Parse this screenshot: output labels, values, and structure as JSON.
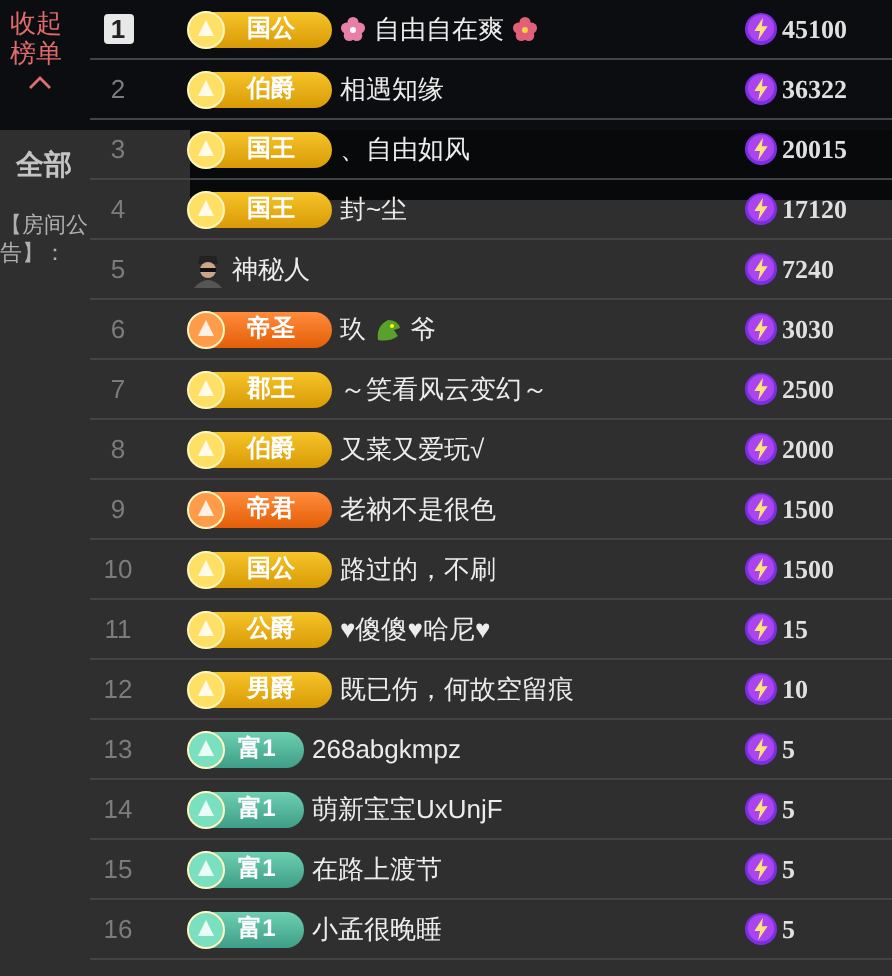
{
  "sidebar": {
    "collapse_label": "收起榜单"
  },
  "tabs": [
    {
      "label": "全部",
      "selected": true
    }
  ],
  "announcement": {
    "label": "【房间公告】："
  },
  "rows": [
    {
      "rank": "1",
      "highlight": true,
      "kind": "gold",
      "badge": "国公",
      "name": "自由自在爽",
      "flower_left": true,
      "flower_right": true,
      "value": "45100"
    },
    {
      "rank": "2",
      "highlight": false,
      "kind": "gold",
      "badge": "伯爵",
      "name": "相遇知缘",
      "value": "36322"
    },
    {
      "rank": "3",
      "highlight": false,
      "kind": "gold",
      "badge": "国王",
      "name": "、自由如风",
      "value": "20015"
    },
    {
      "rank": "4",
      "highlight": false,
      "kind": "gold",
      "badge": "国王",
      "name": "封~尘",
      "value": "17120"
    },
    {
      "rank": "5",
      "highlight": false,
      "kind": "mystery",
      "name": "神秘人",
      "value": "7240"
    },
    {
      "rank": "6",
      "highlight": false,
      "kind": "orange",
      "badge": "帝圣",
      "name": "玖",
      "name_tail": "爷",
      "value": "3030"
    },
    {
      "rank": "7",
      "highlight": false,
      "kind": "gold",
      "badge": "郡王",
      "name": "～笑看风云变幻～",
      "value": "2500"
    },
    {
      "rank": "8",
      "highlight": false,
      "kind": "gold",
      "badge": "伯爵",
      "name": "又菜又爱玩√",
      "value": "2000"
    },
    {
      "rank": "9",
      "highlight": false,
      "kind": "orange",
      "badge": "帝君",
      "name": "老衲不是很色",
      "value": "1500"
    },
    {
      "rank": "10",
      "highlight": false,
      "kind": "gold",
      "badge": "国公",
      "name": "路过的，不刷",
      "value": "1500"
    },
    {
      "rank": "11",
      "highlight": false,
      "kind": "gold",
      "badge": "公爵",
      "name": "♥傻傻♥哈尼♥",
      "value": "15"
    },
    {
      "rank": "12",
      "highlight": false,
      "kind": "gold",
      "badge": "男爵",
      "name": "既已伤，何故空留痕",
      "value": "10"
    },
    {
      "rank": "13",
      "highlight": false,
      "kind": "teal",
      "badge": "富1",
      "name": "268abgkmpz",
      "value": "5"
    },
    {
      "rank": "14",
      "highlight": false,
      "kind": "teal",
      "badge": "富1",
      "name": "萌新宝宝UxUnjF",
      "value": "5"
    },
    {
      "rank": "15",
      "highlight": false,
      "kind": "teal",
      "badge": "富1",
      "name": "在路上渡节",
      "value": "5"
    },
    {
      "rank": "16",
      "highlight": false,
      "kind": "teal",
      "badge": "富1",
      "name": "小孟很晚睡",
      "value": "5"
    }
  ]
}
